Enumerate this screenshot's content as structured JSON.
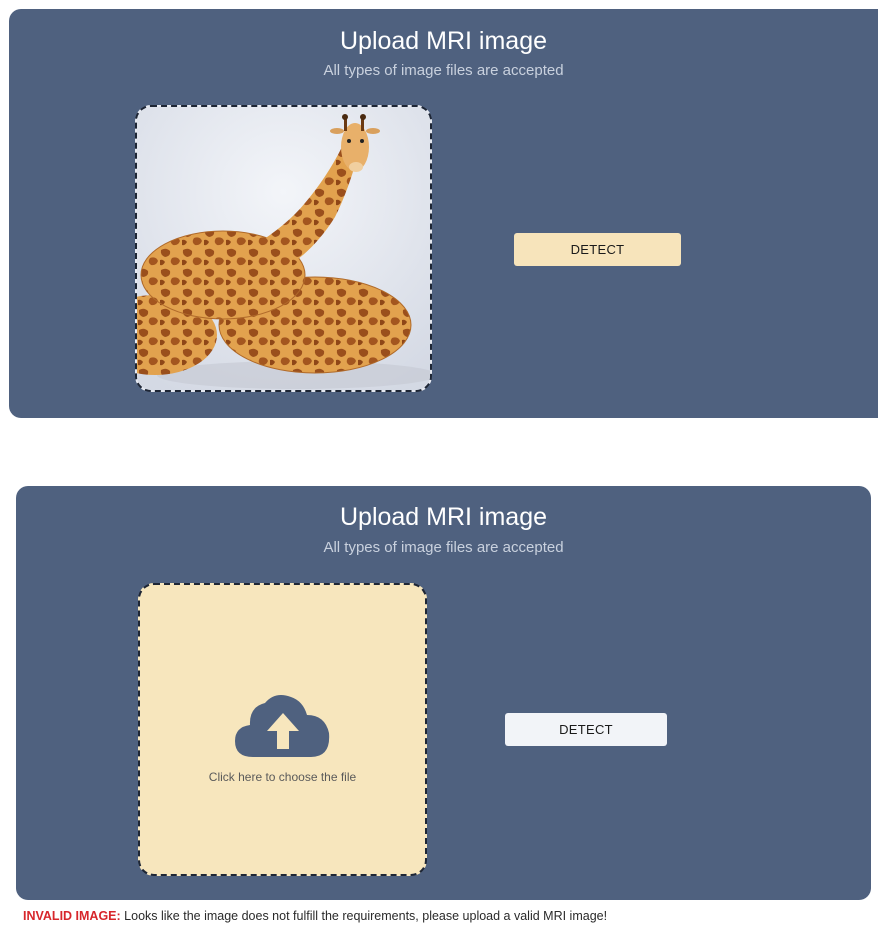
{
  "panels": [
    {
      "title": "Upload MRI image",
      "subtitle": "All types of image files are accepted",
      "preview_image": "giraffe bread loaf photo",
      "detect_label": "DETECT"
    },
    {
      "title": "Upload MRI image",
      "subtitle": "All types of image files are accepted",
      "dropzone_icon": "cloud-upload-icon",
      "dropzone_text": "Click here to choose the file",
      "detect_label": "DETECT"
    }
  ],
  "error": {
    "label": "INVALID IMAGE:",
    "message": " Looks like the image does not fulfill the requirements, please upload a valid MRI image!"
  },
  "colors": {
    "panel_bg": "#4f617f",
    "dropzone_bg": "#f7e6bd",
    "accent_button": "#f7e4bb",
    "error": "#d7262b"
  }
}
